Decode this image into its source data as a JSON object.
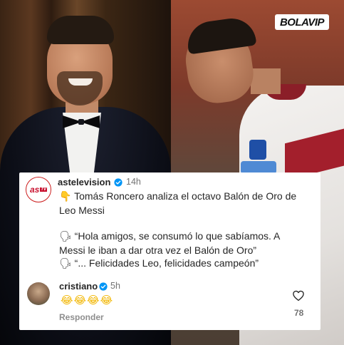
{
  "watermark": {
    "logo_text": "BOLAVIP"
  },
  "post": {
    "author": "astelevision",
    "avatar_label": "as",
    "avatar_badge": "TV",
    "time": "14h",
    "line1_icon": "pointing-down-emoji",
    "line1": "Tomás Roncero analiza el octavo Balón de Oro de",
    "line2": "Leo Messi",
    "quote_icon": "speaking-head-emoji",
    "quote1_line1": "“Hola amigos, se consumó lo que sabíamos. A",
    "quote1_line2": "Messi le iban a dar otra vez el Balón de Oro”",
    "quote2": "“... Felicidades Leo, felicidades campeón”"
  },
  "reply": {
    "author": "cristiano",
    "time": "5h",
    "emojis": "😂😂😂😂",
    "reply_label": "Responder",
    "likes": "78"
  },
  "colors": {
    "verified": "#0095f6",
    "as_red": "#c8102e"
  }
}
